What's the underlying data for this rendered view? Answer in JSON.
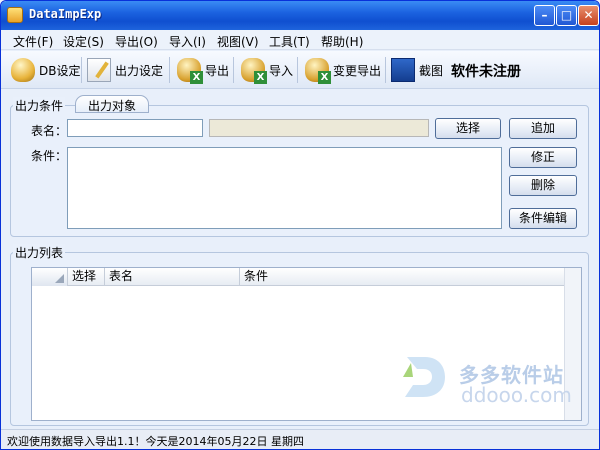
{
  "window": {
    "title": "DataImpExp"
  },
  "menu": [
    "文件(F)",
    "设定(S)",
    "导出(O)",
    "导入(I)",
    "视图(V)",
    "工具(T)",
    "帮助(H)"
  ],
  "toolbar": {
    "db_setting": "DB设定",
    "output_setting": "出力设定",
    "export": "导出",
    "import": "导入",
    "change_export": "变更导出",
    "screenshot": "截图",
    "unregistered": "软件未注册"
  },
  "condition_panel": {
    "title": "出力条件",
    "tab": "出力对象",
    "table_label": "表名：",
    "table_value": "",
    "condition_label": "条件：",
    "condition_value": "",
    "select_button": "选择",
    "add_button": "追加",
    "modify_button": "修正",
    "delete_button": "删除",
    "edit_condition_button": "条件编辑"
  },
  "output_list": {
    "title": "出力列表",
    "columns": [
      "选择",
      "表名",
      "条件"
    ]
  },
  "watermark": {
    "cn": "多多软件站",
    "en": "ddooo.com"
  },
  "status": "欢迎使用数据导入导出1.1！今天是2014年05月22日    星期四"
}
